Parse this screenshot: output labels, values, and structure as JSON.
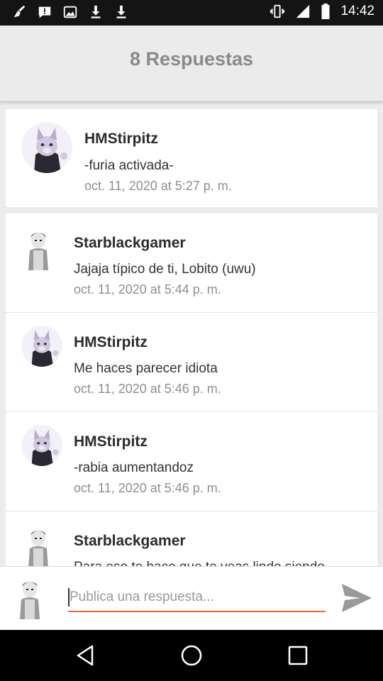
{
  "status_bar": {
    "time": "14:42",
    "left_icons": [
      "broom-icon",
      "notification-icon",
      "image-icon",
      "download-icon",
      "download-icon"
    ],
    "right_icons": [
      "vibrate-icon",
      "signal-icon",
      "battery-icon"
    ]
  },
  "header": {
    "title": "8 Respuestas"
  },
  "original_post": {
    "author": "HMStirpitz",
    "text": "-furia activada-",
    "date": "oct. 11, 2020 at 5:27 p. m."
  },
  "replies": [
    {
      "author": "Starblackgamer",
      "text": "Jajaja típico de ti, Lobito (uwu)",
      "date": "oct. 11, 2020 at 5:44 p. m."
    },
    {
      "author": "HMStirpitz",
      "text": "Me haces parecer idiota",
      "date": "oct. 11, 2020 at 5:46 p. m."
    },
    {
      "author": "HMStirpitz",
      "text": "-rabia aumentandoz",
      "date": "oct. 11, 2020 at 5:46 p. m."
    },
    {
      "author": "Starblackgamer",
      "text": "Para eso te hace que te veas lindo siendo",
      "date": ""
    }
  ],
  "composer": {
    "placeholder": "Publica una respuesta..."
  },
  "colors": {
    "accent": "#f06a2d",
    "name": "#2b2b2b",
    "date": "#8f8f8f",
    "header_title": "#8a8a8a"
  }
}
